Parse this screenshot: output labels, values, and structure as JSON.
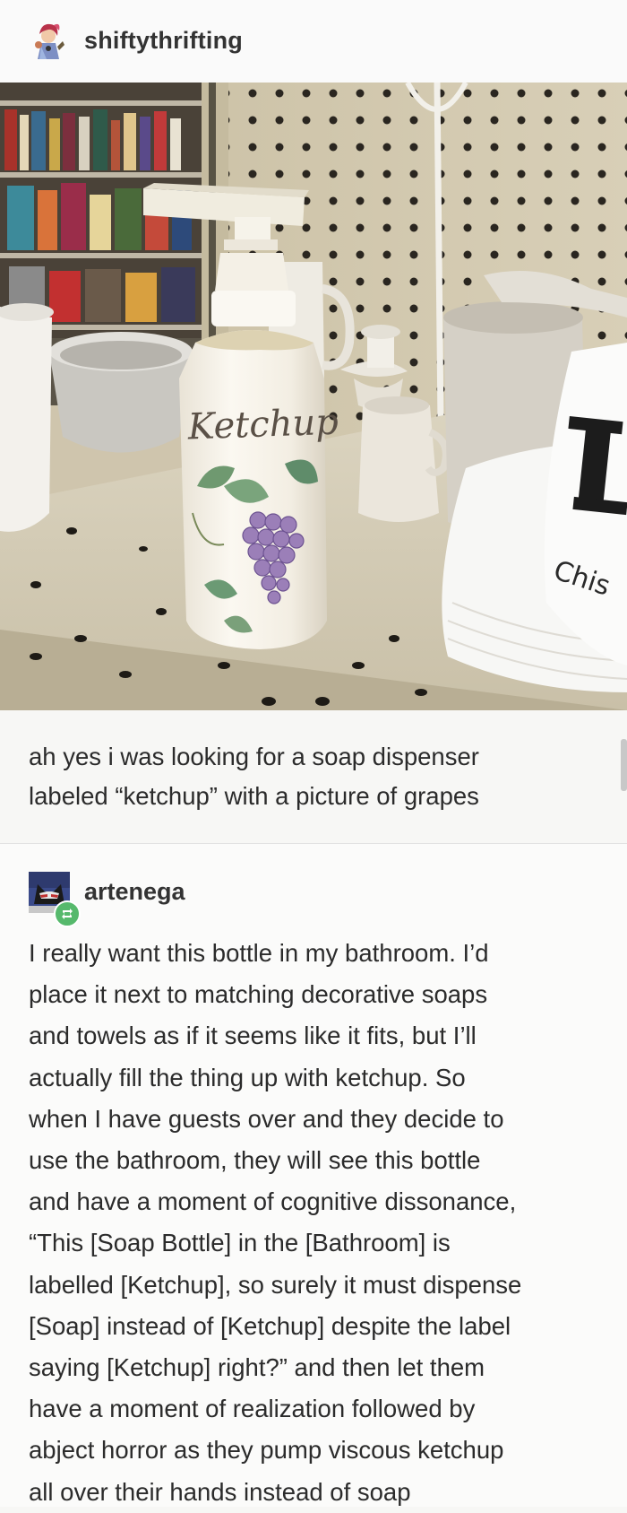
{
  "original_post": {
    "username": "shiftythrifting",
    "photo": {
      "bottle_label": "Ketchup",
      "mug_text_letter": "I",
      "mug_text_word": "Chis"
    },
    "caption_lines": [
      "ah yes i was looking for a soap dispenser",
      "labeled “ketchup” with a picture of grapes"
    ]
  },
  "reblog": {
    "username": "artenega",
    "badge_icon": "reblog-icon",
    "body_lines": [
      "I really want this bottle in my bathroom. I’d",
      "place it next to matching decorative soaps",
      "and towels as if it seems like it fits, but I’ll",
      "actually fill the thing up with ketchup. So",
      "when I have guests over and they decide to",
      "use the bathroom, they will see this bottle",
      "and have a moment of cognitive dissonance,",
      "“This [Soap Bottle] in the [Bathroom] is",
      "labelled [Ketchup], so surely it must dispense",
      "[Soap] instead of [Ketchup] despite the label",
      "saying [Ketchup] right?” and then let them",
      "have a moment of realization followed by",
      "abject horror as they pump viscous ketchup",
      "all over their hands instead of soap"
    ]
  },
  "colors": {
    "reblog_badge": "#56b96c",
    "text": "#2b2b2b"
  }
}
